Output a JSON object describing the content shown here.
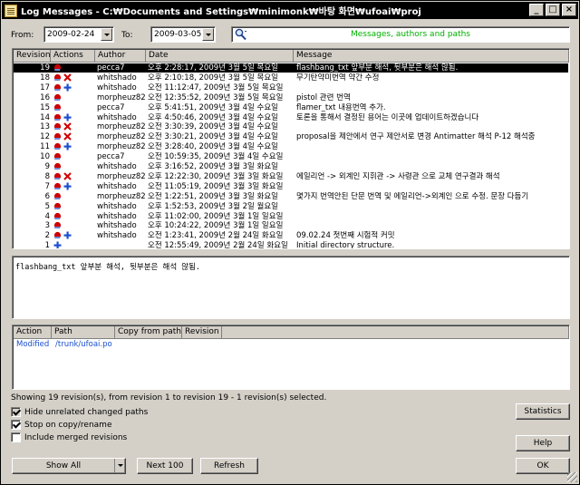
{
  "window": {
    "title": "Log Messages - C:₩Documents and Settings₩minimonk₩바탕 화면₩ufoai₩proj",
    "btn_minimize": "_",
    "btn_maximize": "□",
    "btn_close": "×"
  },
  "filter": {
    "from_label": "From:",
    "from_value": "2009-02-24",
    "to_label": "To:",
    "to_value": "2009-03-05",
    "search_placeholder": "Messages, authors and paths"
  },
  "log_table": {
    "headers": [
      "Revision",
      "Actions",
      "Author",
      "Date",
      "Message"
    ],
    "rows": [
      {
        "rev": "19",
        "author": "pecca7",
        "date": "오후 2:28:17, 2009년 3월 5일 목요일",
        "msg": "flashbang_txt 앞부분 해석, 뒷부분은 해석 않됨.",
        "icons": [
          "mod"
        ],
        "selected": true
      },
      {
        "rev": "18",
        "author": "whitshado",
        "date": "오후 2:10:18, 2009년 3월 5일 목요일",
        "msg": "무기탄약미번역 약간 수정",
        "icons": [
          "mod",
          "del"
        ]
      },
      {
        "rev": "17",
        "author": "whitshado",
        "date": "오전 11:12:47, 2009년 3월 5일 목요일",
        "msg": "",
        "icons": [
          "mod",
          "add"
        ]
      },
      {
        "rev": "16",
        "author": "morpheuz82",
        "date": "오전 12:35:52, 2009년 3월 5일 목요일",
        "msg": "pistol 관련 번역",
        "icons": [
          "mod"
        ]
      },
      {
        "rev": "15",
        "author": "pecca7",
        "date": "오후 5:41:51, 2009년 3월 4일 수요일",
        "msg": "flamer_txt 내용번역 추가.",
        "icons": [
          "mod"
        ]
      },
      {
        "rev": "14",
        "author": "whitshado",
        "date": "오후 4:50:46, 2009년 3월 4일 수요일",
        "msg": "토론을 통해서 결정된 용어는 이곳에 업데이트하겠습니다",
        "icons": [
          "mod",
          "add"
        ]
      },
      {
        "rev": "13",
        "author": "morpheuz82",
        "date": "오전 3:30:39, 2009년 3월 4일 수요일",
        "msg": "",
        "icons": [
          "mod",
          "del"
        ]
      },
      {
        "rev": "12",
        "author": "morpheuz82",
        "date": "오전 3:30:21, 2009년 3월 4일 수요일",
        "msg": "proposal을 제안에서 연구 제안서로 변경 Antimatter 해석 P-12 해석중",
        "icons": [
          "mod",
          "del"
        ]
      },
      {
        "rev": "11",
        "author": "morpheuz82",
        "date": "오전 3:28:40, 2009년 3월 4일 수요일",
        "msg": "",
        "icons": [
          "mod",
          "add"
        ]
      },
      {
        "rev": "10",
        "author": "pecca7",
        "date": "오전 10:59:35, 2009년 3월 4일 수요일",
        "msg": "",
        "icons": [
          "mod"
        ]
      },
      {
        "rev": "9",
        "author": "whitshado",
        "date": "오후 3:16:52, 2009년 3월 3일 화요일",
        "msg": "",
        "icons": [
          "mod"
        ]
      },
      {
        "rev": "8",
        "author": "morpheuz82",
        "date": "오후 12:22:30, 2009년 3월 3일 화요일",
        "msg": "에일리언 -> 외계인 지휘관 -> 사령관 으로 교체 연구결과 해석",
        "icons": [
          "mod",
          "del"
        ]
      },
      {
        "rev": "7",
        "author": "whitshado",
        "date": "오전 11:05:19, 2009년 3월 3일 화요일",
        "msg": "",
        "icons": [
          "mod",
          "add"
        ]
      },
      {
        "rev": "6",
        "author": "morpheuz82",
        "date": "오전 1:22:51, 2009년 3월 3일 화요일",
        "msg": "몇가지 번역안된 단문 번역 및 에일리언->외계인 으로 수정. 문장 다듬기",
        "icons": [
          "mod"
        ]
      },
      {
        "rev": "5",
        "author": "whitshado",
        "date": "오후 1:52:53, 2009년 3월 2일 월요일",
        "msg": "",
        "icons": [
          "mod"
        ]
      },
      {
        "rev": "4",
        "author": "whitshado",
        "date": "오후 11:02:00, 2009년 3월 1일 일요일",
        "msg": "",
        "icons": [
          "mod"
        ]
      },
      {
        "rev": "3",
        "author": "whitshado",
        "date": "오후 10:24:22, 2009년 3월 1일 일요일",
        "msg": "",
        "icons": [
          "mod"
        ]
      },
      {
        "rev": "2",
        "author": "whitshado",
        "date": "오전 1:23:41, 2009년 2월 24일 화요일",
        "msg": "09.02.24 첫번째 시험적 커밋",
        "icons": [
          "mod",
          "add"
        ]
      },
      {
        "rev": "1",
        "author": "",
        "date": "오전 12:55:49, 2009년 2월 24일 화요일",
        "msg": "Initial directory structure.",
        "icons": [
          "add"
        ]
      }
    ]
  },
  "message_panel": {
    "text": "flashbang_txt 앞부분 해석, 뒷부분은 해석 않됨."
  },
  "paths_table": {
    "headers": [
      "Action",
      "Path",
      "Copy from path",
      "Revision"
    ],
    "rows": [
      {
        "action": "Modified",
        "path": "/trunk/ufoai.po",
        "copy_from": "",
        "revision": ""
      }
    ]
  },
  "status": {
    "text": "Showing 19 revision(s), from revision 1 to revision 19 - 1 revision(s) selected."
  },
  "options": {
    "hide_unrelated": "Hide unrelated changed paths",
    "stop_on_copy": "Stop on copy/rename",
    "include_merged": "Include merged revisions"
  },
  "buttons": {
    "show_all": "Show All",
    "next_100": "Next 100",
    "refresh": "Refresh",
    "statistics": "Statistics",
    "help": "Help",
    "ok": "OK"
  },
  "colors": {
    "modified": "#cc0000",
    "added": "#1a4fd0",
    "deleted": "#d00000",
    "path_text": "#1a4fd0",
    "search_text": "#00b000"
  }
}
